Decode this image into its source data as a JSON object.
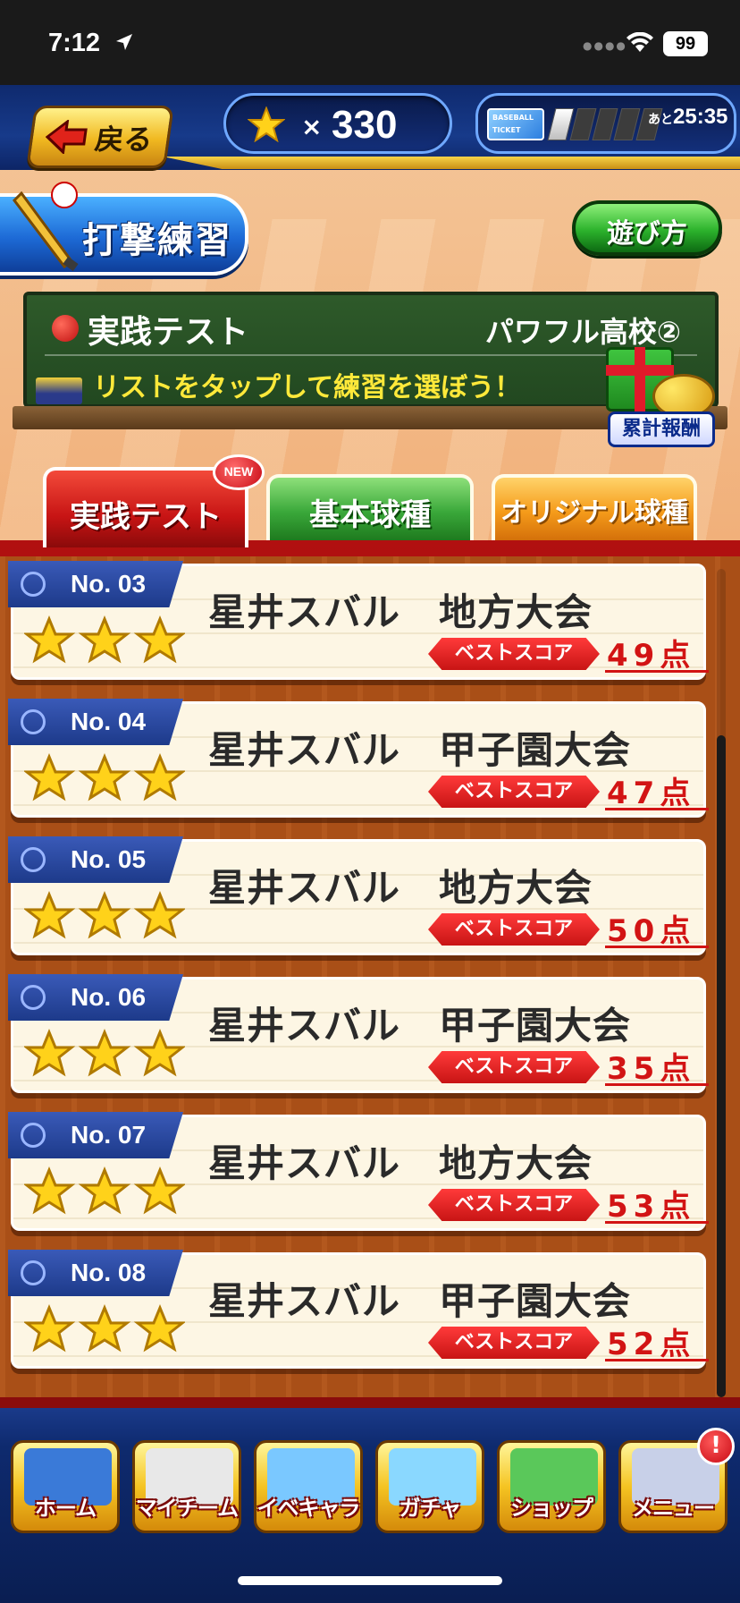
{
  "status_bar": {
    "time": "7:12",
    "battery": "99",
    "icons": [
      "location-arrow-icon",
      "cellular-dots-icon",
      "wifi-icon",
      "battery-icon"
    ]
  },
  "header": {
    "back_label": "戻る",
    "star_count_prefix": "×",
    "star_count": "330",
    "ticket_timer_prefix": "あと",
    "ticket_timer": "25:35",
    "ticket_filled_bars": 1,
    "ticket_total_bars": 5
  },
  "practice": {
    "title": "打撃練習",
    "howto_label": "遊び方"
  },
  "board": {
    "title": "実践テスト",
    "school": "パワフル高校②",
    "hint": "リストをタップして練習を選ぼう！",
    "reward_label": "累計報酬"
  },
  "tabs": [
    {
      "label": "実践テスト",
      "active": true,
      "badge": "NEW"
    },
    {
      "label": "基本球種",
      "active": false
    },
    {
      "label": "オリジナル球種",
      "active": false
    }
  ],
  "best_score_label": "ベストスコア",
  "cards": [
    {
      "no": "No. 03",
      "title": "星井スバル　地方大会",
      "score": "49点",
      "stars": 3
    },
    {
      "no": "No. 04",
      "title": "星井スバル　甲子園大会",
      "score": "47点",
      "stars": 3
    },
    {
      "no": "No. 05",
      "title": "星井スバル　地方大会",
      "score": "50点",
      "stars": 3
    },
    {
      "no": "No. 06",
      "title": "星井スバル　甲子園大会",
      "score": "35点",
      "stars": 3
    },
    {
      "no": "No. 07",
      "title": "星井スバル　地方大会",
      "score": "53点",
      "stars": 3
    },
    {
      "no": "No. 08",
      "title": "星井スバル　甲子園大会",
      "score": "52点",
      "stars": 3
    }
  ],
  "nav": [
    {
      "label": "ホーム",
      "icon": "home-notebook-icon",
      "color": "#3a7ad8"
    },
    {
      "label": "マイチーム",
      "icon": "team-players-icon",
      "color": "#e8e8e8"
    },
    {
      "label": "イベキャラ",
      "icon": "event-character-icon",
      "color": "#7ac8ff"
    },
    {
      "label": "ガチャ",
      "icon": "gacha-magnifier-icon",
      "color": "#8ad8ff"
    },
    {
      "label": "ショップ",
      "icon": "shop-building-icon",
      "color": "#5ac85a"
    },
    {
      "label": "メニュー",
      "icon": "menu-clipboard-icon",
      "color": "#c8d0e8"
    }
  ],
  "menu_alert": "!",
  "colors": {
    "active_tab": "#c71414",
    "basic_tab": "#3aa83a",
    "original_tab": "#f59b1a",
    "score_red": "#d21414",
    "header_navy": "#0f2a6e"
  }
}
